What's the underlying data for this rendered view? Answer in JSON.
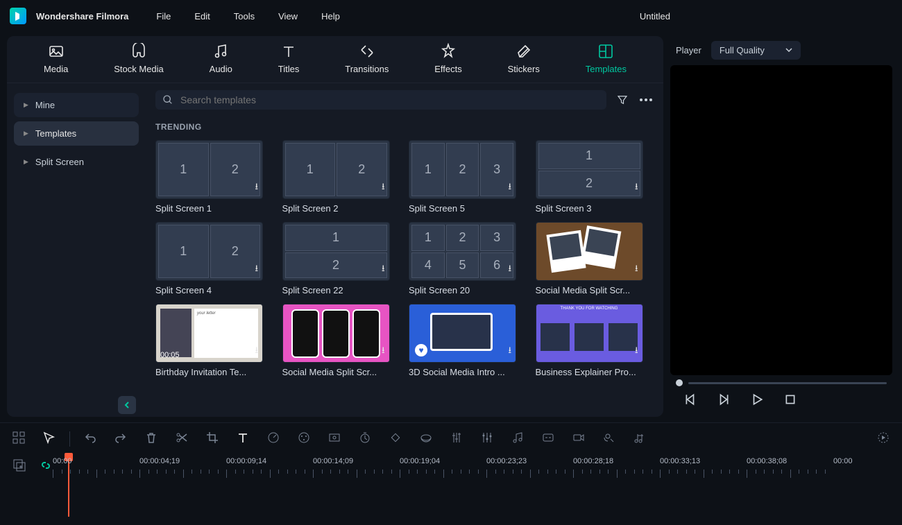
{
  "app": {
    "name": "Wondershare Filmora",
    "project": "Untitled"
  },
  "menubar": [
    "File",
    "Edit",
    "Tools",
    "View",
    "Help"
  ],
  "tabs": [
    {
      "label": "Media"
    },
    {
      "label": "Stock Media"
    },
    {
      "label": "Audio"
    },
    {
      "label": "Titles"
    },
    {
      "label": "Transitions"
    },
    {
      "label": "Effects"
    },
    {
      "label": "Stickers"
    },
    {
      "label": "Templates",
      "active": true
    }
  ],
  "sidebar": {
    "items": [
      {
        "label": "Mine"
      },
      {
        "label": "Templates",
        "active": true
      },
      {
        "label": "Split Screen"
      }
    ]
  },
  "search": {
    "placeholder": "Search templates"
  },
  "section": "TRENDING",
  "templates": [
    {
      "label": "Split Screen 1"
    },
    {
      "label": "Split Screen 2"
    },
    {
      "label": "Split Screen 5"
    },
    {
      "label": "Split Screen 3"
    },
    {
      "label": "Split Screen 4"
    },
    {
      "label": "Split Screen 22"
    },
    {
      "label": "Split Screen 20"
    },
    {
      "label": "Social Media Split Scr..."
    },
    {
      "label": "Birthday Invitation Te...",
      "duration": "00:05"
    },
    {
      "label": "Social Media Split Scr..."
    },
    {
      "label": "3D Social Media Intro ..."
    },
    {
      "label": "Business Explainer Pro..."
    }
  ],
  "player": {
    "label": "Player",
    "quality": "Full Quality"
  },
  "ruler": [
    "00:00",
    "00:00:04;19",
    "00:00:09;14",
    "00:00:14;09",
    "00:00:19;04",
    "00:00:23;23",
    "00:00:28;18",
    "00:00:33;13",
    "00:00:38;08",
    "00:00"
  ]
}
